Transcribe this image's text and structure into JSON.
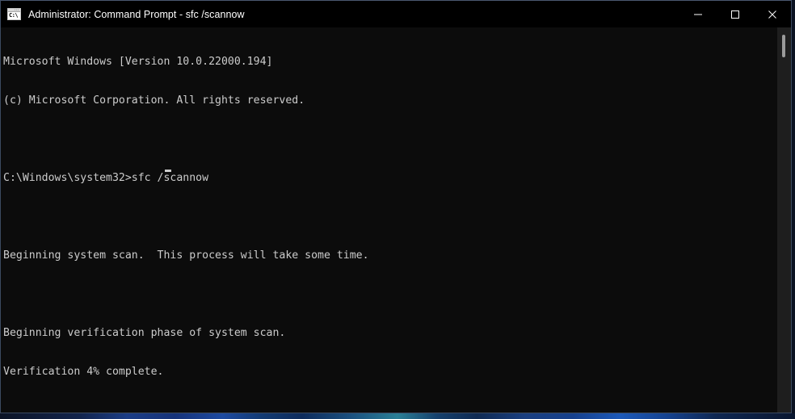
{
  "window": {
    "title": "Administrator: Command Prompt - sfc  /scannow",
    "icon_name": "command-prompt-icon",
    "icon_glyph": "C:\\",
    "background_color": "#0c0c0c",
    "titlebar_color": "#000000",
    "border_color": "#3c4a60",
    "controls": {
      "minimize_label": "Minimize",
      "maximize_label": "Maximize",
      "close_label": "Close"
    }
  },
  "console": {
    "foreground_color": "#cccccc",
    "lines": [
      "Microsoft Windows [Version 10.0.22000.194]",
      "(c) Microsoft Corporation. All rights reserved.",
      "",
      "C:\\Windows\\system32>sfc /scannow",
      "",
      "Beginning system scan.  This process will take some time.",
      "",
      "Beginning verification phase of system scan.",
      "Verification 4% complete."
    ],
    "os_version": "10.0.22000.194",
    "copyright": "(c) Microsoft Corporation. All rights reserved.",
    "prompt_path": "C:\\Windows\\system32>",
    "command": "sfc /scannow",
    "progress_percent": "4%",
    "status_message": "Verification 4% complete.",
    "cursor_visible": true
  },
  "scrollbar": {
    "name": "console-scrollbar",
    "thumb_position": "top",
    "track_color": "#1e1e1e",
    "thumb_color": "#9a9a9a"
  },
  "desktop": {
    "wallpaper_description": "blue abstract wallpaper",
    "accent_color": "#1c59b8"
  }
}
